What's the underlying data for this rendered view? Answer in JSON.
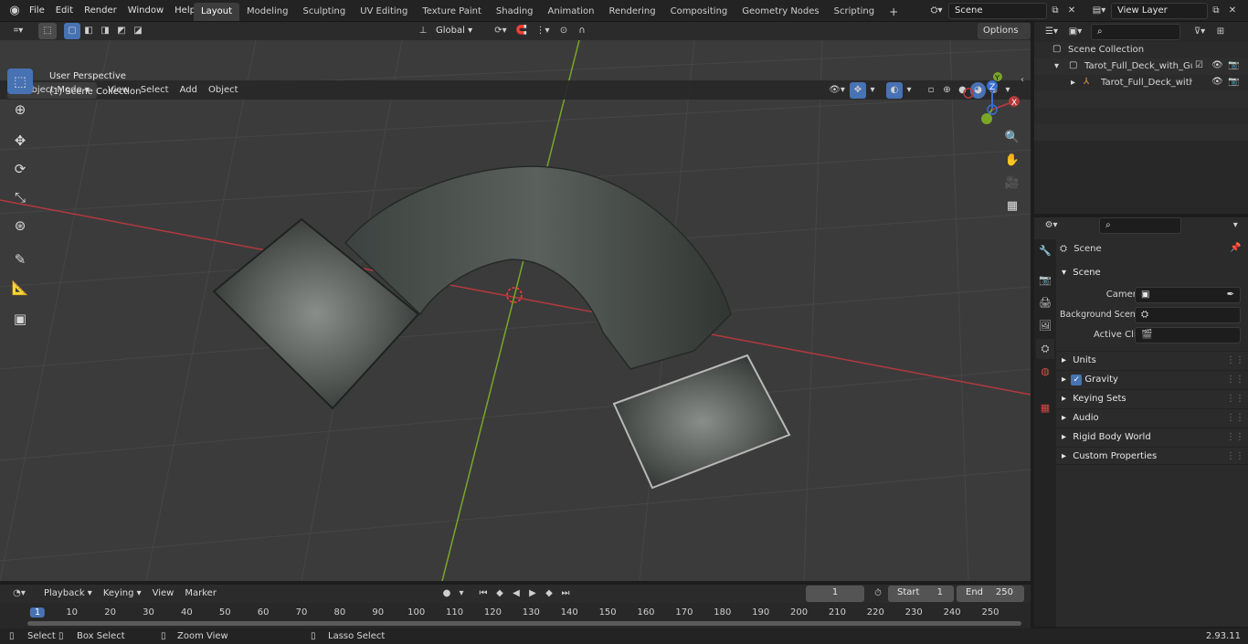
{
  "topbar": {
    "menus": [
      "File",
      "Edit",
      "Render",
      "Window",
      "Help"
    ],
    "workspaces": [
      "Layout",
      "Modeling",
      "Sculpting",
      "UV Editing",
      "Texture Paint",
      "Shading",
      "Animation",
      "Rendering",
      "Compositing",
      "Geometry Nodes",
      "Scripting"
    ],
    "active_workspace": "Layout",
    "add_tab": "+",
    "scene_name": "Scene",
    "view_layer": "View Layer"
  },
  "tool_header": {
    "orientation": "Global",
    "options": "Options"
  },
  "viewport_header": {
    "mode": "Object Mode",
    "menus": [
      "View",
      "Select",
      "Add",
      "Object"
    ]
  },
  "viewport": {
    "perspective_label": "User Perspective",
    "collection_label": "(1) Scene Collection",
    "gizmo": {
      "x": "X",
      "y": "Y",
      "z": "Z"
    },
    "axis_colors": {
      "x": "#b3393c",
      "y": "#7aa628",
      "z": "#3a6fd1"
    }
  },
  "outliner": {
    "root": "Scene Collection",
    "items": [
      {
        "label": "Tarot_Full_Deck_with_Guidebook"
      },
      {
        "label": "Tarot_Full_Deck_with_Gu"
      }
    ]
  },
  "properties": {
    "breadcrumb": "Scene",
    "section": "Scene",
    "fields": [
      {
        "label": "Camera"
      },
      {
        "label": "Background Scene"
      },
      {
        "label": "Active Clip"
      }
    ],
    "panels": [
      "Units",
      "Gravity",
      "Keying Sets",
      "Audio",
      "Rigid Body World",
      "Custom Properties"
    ]
  },
  "timeline": {
    "menus": [
      "Playback",
      "Keying",
      "View",
      "Marker"
    ],
    "current_frame": "1",
    "start_label": "Start",
    "start_value": "1",
    "end_label": "End",
    "end_value": "250",
    "ruler": [
      "1",
      "10",
      "20",
      "30",
      "40",
      "50",
      "60",
      "70",
      "80",
      "90",
      "100",
      "110",
      "120",
      "130",
      "140",
      "150",
      "160",
      "170",
      "180",
      "190",
      "200",
      "210",
      "220",
      "230",
      "240",
      "250"
    ]
  },
  "statusbar": {
    "select": "Select",
    "box_select": "Box Select",
    "zoom_view": "Zoom View",
    "lasso_select": "Lasso Select",
    "version": "2.93.11"
  }
}
